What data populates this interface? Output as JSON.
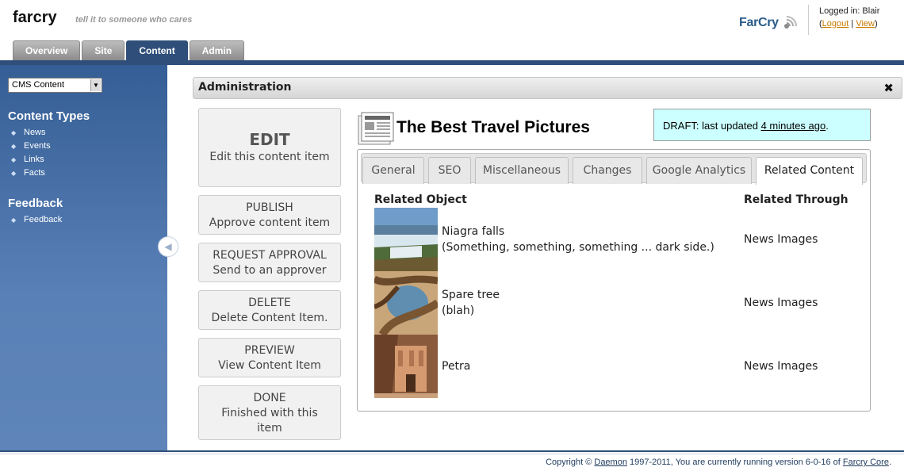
{
  "header": {
    "site_name": "farcry",
    "tagline": "tell it to someone who cares",
    "brand": "FarCry",
    "logged_in": "Logged in: Blair",
    "logout": "Logout",
    "view": "View",
    "tabs": [
      {
        "label": "Overview"
      },
      {
        "label": "Site"
      },
      {
        "label": "Content",
        "active": true
      },
      {
        "label": "Admin"
      }
    ]
  },
  "sidebar": {
    "select_value": "CMS Content",
    "section1": {
      "title": "Content Types",
      "items": [
        {
          "label": "News"
        },
        {
          "label": "Events"
        },
        {
          "label": "Links"
        },
        {
          "label": "Facts"
        }
      ]
    },
    "section2": {
      "title": "Feedback",
      "items": [
        {
          "label": "Feedback"
        }
      ]
    }
  },
  "admin": {
    "title": "Administration",
    "close": "✖"
  },
  "actions": [
    {
      "title": "EDIT",
      "desc": "Edit this content item"
    },
    {
      "title": "PUBLISH",
      "desc": "Approve content item"
    },
    {
      "title": "REQUEST APPROVAL",
      "desc": "Send to an approver"
    },
    {
      "title": "DELETE",
      "desc": "Delete Content Item."
    },
    {
      "title": "PREVIEW",
      "desc": "View Content Item"
    },
    {
      "title": "DONE",
      "desc": "Finished with this item"
    }
  ],
  "item": {
    "title": "The Best Travel Pictures",
    "status_prefix": "DRAFT: last updated ",
    "status_time": "4 minutes ago",
    "status_suffix": "."
  },
  "tabs": [
    {
      "label": "General"
    },
    {
      "label": "SEO"
    },
    {
      "label": "Miscellaneous"
    },
    {
      "label": "Changes"
    },
    {
      "label": "Google Analytics"
    },
    {
      "label": "Related Content",
      "active": true
    }
  ],
  "related": {
    "col_object": "Related Object",
    "col_through": "Related Through",
    "rows": [
      {
        "title": "Niagra falls",
        "sub": "(Something, something, something ... dark side.)",
        "through": "News Images"
      },
      {
        "title": "Spare tree",
        "sub": "(blah)",
        "through": "News Images"
      },
      {
        "title": "Petra",
        "sub": "",
        "through": "News Images"
      }
    ]
  },
  "footer": {
    "prefix": "Copyright © ",
    "daemon": "Daemon",
    "middle": " 1997-2011, You are currently running version 6-0-16 of ",
    "core": "Farcry Core",
    "suffix": "."
  },
  "colors": {
    "nav": "#2f4f7a",
    "sidebar_top": "#345e95",
    "sidebar_bottom": "#5e84b9",
    "draft_bg": "#ccffff",
    "link_orange": "#c87a00"
  }
}
